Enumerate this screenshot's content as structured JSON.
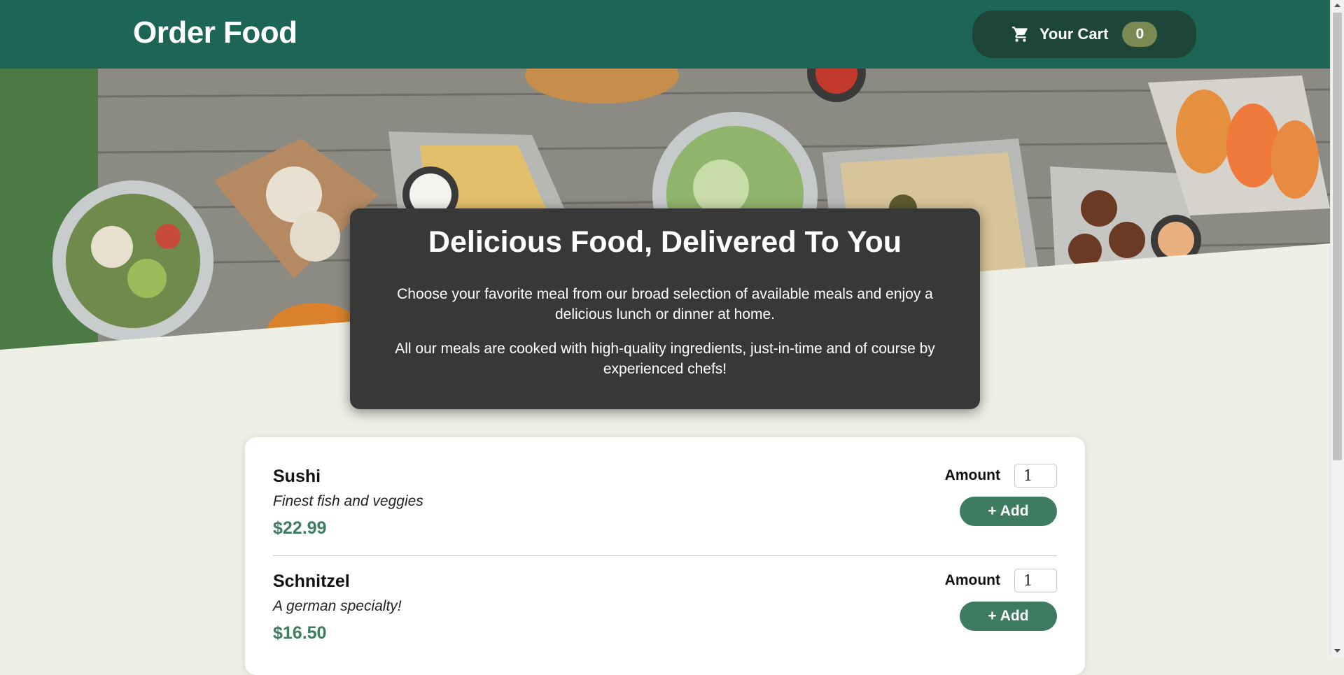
{
  "header": {
    "brand": "Order Food",
    "cart_label": "Your Cart",
    "cart_count": "0"
  },
  "hero": {
    "image": "Assorted meals on a wooden table"
  },
  "summary": {
    "title": "Delicious Food, Delivered To You",
    "paragraphs": [
      "Choose your favorite meal from our broad selection of available meals and enjoy a delicious lunch or dinner at home.",
      "All our meals are cooked with high-quality ingredients, just-in-time and of course by experienced chefs!"
    ]
  },
  "meals": [
    {
      "name": "Sushi",
      "description": "Finest fish and veggies",
      "price": "$22.99",
      "amount_label": "Amount",
      "amount_value": "1",
      "add_label": "+ Add"
    },
    {
      "name": "Schnitzel",
      "description": "A german specialty!",
      "price": "$16.50",
      "amount_label": "Amount",
      "amount_value": "1",
      "add_label": "+ Add"
    }
  ],
  "colors": {
    "header": "#1d6657",
    "cart_button": "#1d4538",
    "badge": "#7b8a52",
    "accent": "#3d7c61",
    "page_bg": "#eef0e6",
    "summary_bg": "#383838"
  },
  "icons": {
    "cart": "shopping-cart-icon"
  }
}
